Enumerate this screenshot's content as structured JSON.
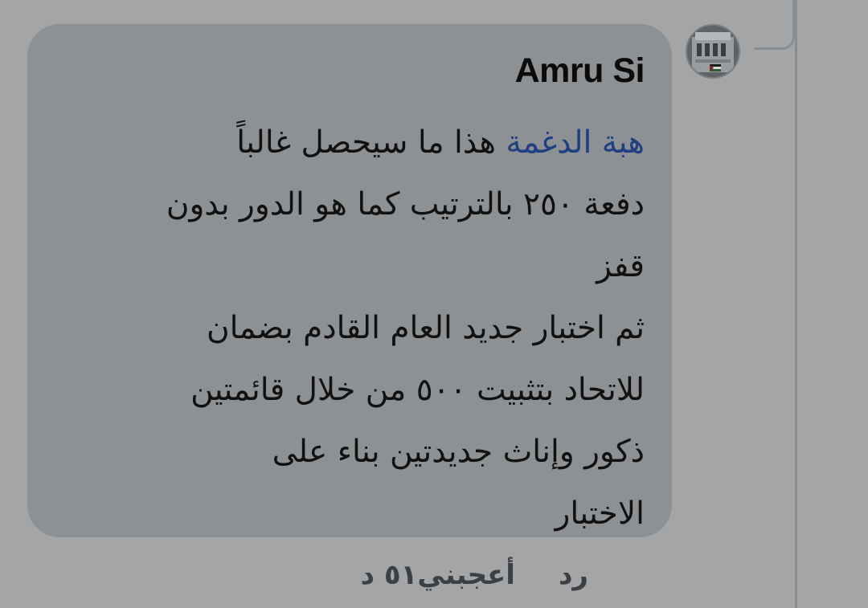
{
  "comment": {
    "author": "Amru Si",
    "mention": "هبة الدغمة",
    "first_line_rest": " هذا ما سيحصل غالباً",
    "lines": [
      "دفعة ٢٥٠ بالترتيب كما هو الدور بدون",
      "قفز",
      "ثم اختبار جديد العام القادم بضمان",
      "للاتحاد بتثبيت ٥٠٠ من خلال قائمتين",
      "ذكور وإناث جديدتين بناء على",
      "الاختبار"
    ]
  },
  "actions": {
    "time": "٥١ د",
    "like": "أعجبني",
    "reply": "رد"
  },
  "avatar": {
    "icon": "profile-photo-building-with-flag-icon"
  },
  "colors": {
    "background": "#a3a5a7",
    "bubble": "#8e9194",
    "mention": "#1f3f80",
    "text": "#111111",
    "actions": "#3d4043"
  }
}
